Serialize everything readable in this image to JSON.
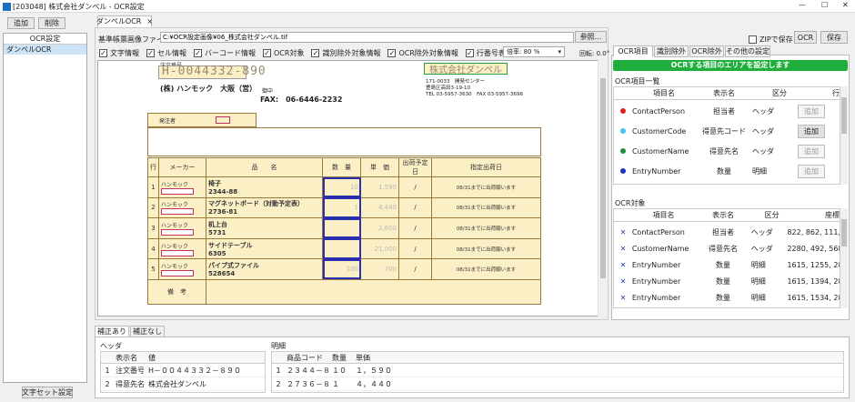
{
  "window": {
    "title": "[203048] 株式会社ダンペル - OCR設定",
    "min": "—",
    "max": "☐",
    "close": "✕"
  },
  "left": {
    "add_label": "追加",
    "delete_label": "削除",
    "header": "OCR設定",
    "items": [
      "ダンペルOCR"
    ],
    "bottom_button": "文字セット設定"
  },
  "doc_tab": {
    "label": "ダンペルOCR",
    "close": "×"
  },
  "file": {
    "label": "基準帳票画像ファイル",
    "path": "C:¥OCR設定画像¥06_株式会社ダンペル.tif",
    "browse": "参照..."
  },
  "checks": [
    {
      "label": "文字情報",
      "checked": true
    },
    {
      "label": "セル情報",
      "checked": true
    },
    {
      "label": "バーコード情報",
      "checked": true
    },
    {
      "label": "OCR対象",
      "checked": true
    },
    {
      "label": "識別除外対象情報",
      "checked": true
    },
    {
      "label": "OCR除外対象情報",
      "checked": true
    },
    {
      "label": "行番号表示",
      "checked": true
    }
  ],
  "zoom": {
    "label": "倍率: 80 %",
    "rotate": "回転: 0.0°"
  },
  "form": {
    "order_label": "注文番号",
    "order_no": "H-0044332-890",
    "customer_box": "株式会社ダンペル",
    "from_name": "(株) ハンモック　大阪（営）",
    "from_suffix": "御中",
    "fax": "FAX:　06-6446-2232",
    "to_address": [
      "171-0033　開発センター",
      "豊島区高田3-19-10",
      "TEL 03-5957-3630　FAX 03-5957-3696"
    ],
    "orderer_label": "発注者",
    "headers": [
      "行",
      "メーカー",
      "品　　名",
      "数　量",
      "単　価",
      "出荷予定日",
      "指定出荷日"
    ],
    "rows": [
      {
        "no": "1",
        "maker": "ハンモック",
        "item1": "椅子",
        "item2": "2344-88",
        "qty": "10",
        "price": "1,590",
        "date": "/",
        "note": "08/31までに出荷願います"
      },
      {
        "no": "2",
        "maker": "ハンモック",
        "item1": "マグネットボード（対動予定表）",
        "item2": "2736-81",
        "qty": "1",
        "price": "4,440",
        "date": "/",
        "note": "08/31までに出荷願います"
      },
      {
        "no": "3",
        "maker": "ハンモック",
        "item1": "机上台",
        "item2": "5731",
        "qty": "",
        "price": "2,600",
        "date": "/",
        "note": "08/31までに出荷願います"
      },
      {
        "no": "4",
        "maker": "ハンモック",
        "item1": "サイドテーブル",
        "item2": "6305",
        "qty": "",
        "price": "21,000",
        "date": "/",
        "note": "08/31までに出荷願います"
      },
      {
        "no": "5",
        "maker": "ハンモック",
        "item1": "パイプ式ファイル",
        "item2": "528654",
        "qty": "100",
        "price": "700",
        "date": "/",
        "note": "08/31までに出荷願います"
      }
    ],
    "remarks_label": "備　考"
  },
  "right": {
    "zip_label": "ZIPで保存",
    "ocr_btn": "OCR",
    "save_btn": "保存",
    "tabs": [
      "OCR項目",
      "識別除外",
      "OCR除外",
      "その他の設定"
    ],
    "green_btn": "OCRする項目のエリアを設定します",
    "list1_title": "OCR項目一覧",
    "list1_headers": [
      "項目名",
      "表示名",
      "区分",
      "行"
    ],
    "list1_rows": [
      {
        "name": "ContactPerson",
        "disp": "担当者",
        "kind": "ヘッダ",
        "btn": "追加",
        "color": "#e02020"
      },
      {
        "name": "CustomerCode",
        "disp": "得意先コード",
        "kind": "ヘッダ",
        "btn": "追加",
        "color": "#40c8e0"
      },
      {
        "name": "CustomerName",
        "disp": "得意先名",
        "kind": "ヘッダ",
        "btn": "追加",
        "color": "#209040"
      },
      {
        "name": "EntryNumber",
        "disp": "数量",
        "kind": "明細",
        "btn": "追加",
        "color": "#2030c0"
      }
    ],
    "list2_title": "OCR対象",
    "list2_headers": [
      "項目名",
      "表示名",
      "区分",
      "座標"
    ],
    "list2_rows": [
      {
        "x": "✕",
        "name": "ContactPerson",
        "disp": "担当者",
        "kind": "ヘッダ",
        "coord": "822, 862, 111,"
      },
      {
        "x": "✕",
        "name": "CustomerName",
        "disp": "得意先名",
        "kind": "ヘッダ",
        "coord": "2280, 492, 568"
      },
      {
        "x": "✕",
        "name": "EntryNumber",
        "disp": "数量",
        "kind": "明細",
        "coord": "1615, 1255, 28"
      },
      {
        "x": "✕",
        "name": "EntryNumber",
        "disp": "数量",
        "kind": "明細",
        "coord": "1615, 1394, 28"
      },
      {
        "x": "✕",
        "name": "EntryNumber",
        "disp": "数量",
        "kind": "明細",
        "coord": "1615, 1534, 28"
      }
    ]
  },
  "bottom": {
    "tabs": [
      "補正あり",
      "補正なし"
    ],
    "header_title": "ヘッダ",
    "header_cols": [
      "表示名",
      "値"
    ],
    "header_rows": [
      [
        "1",
        "注文番号",
        "H－００４４３３２－８９０"
      ],
      [
        "2",
        "得意先名",
        "株式会社ダンペル"
      ]
    ],
    "detail_title": "明細",
    "detail_cols": [
      "商品コード",
      "数量",
      "単価"
    ],
    "detail_rows": [
      [
        "1",
        "２３４４－８８",
        "１０",
        "１，５９０"
      ],
      [
        "2",
        "２７３６－８１",
        "１",
        "４，４４０"
      ]
    ]
  }
}
